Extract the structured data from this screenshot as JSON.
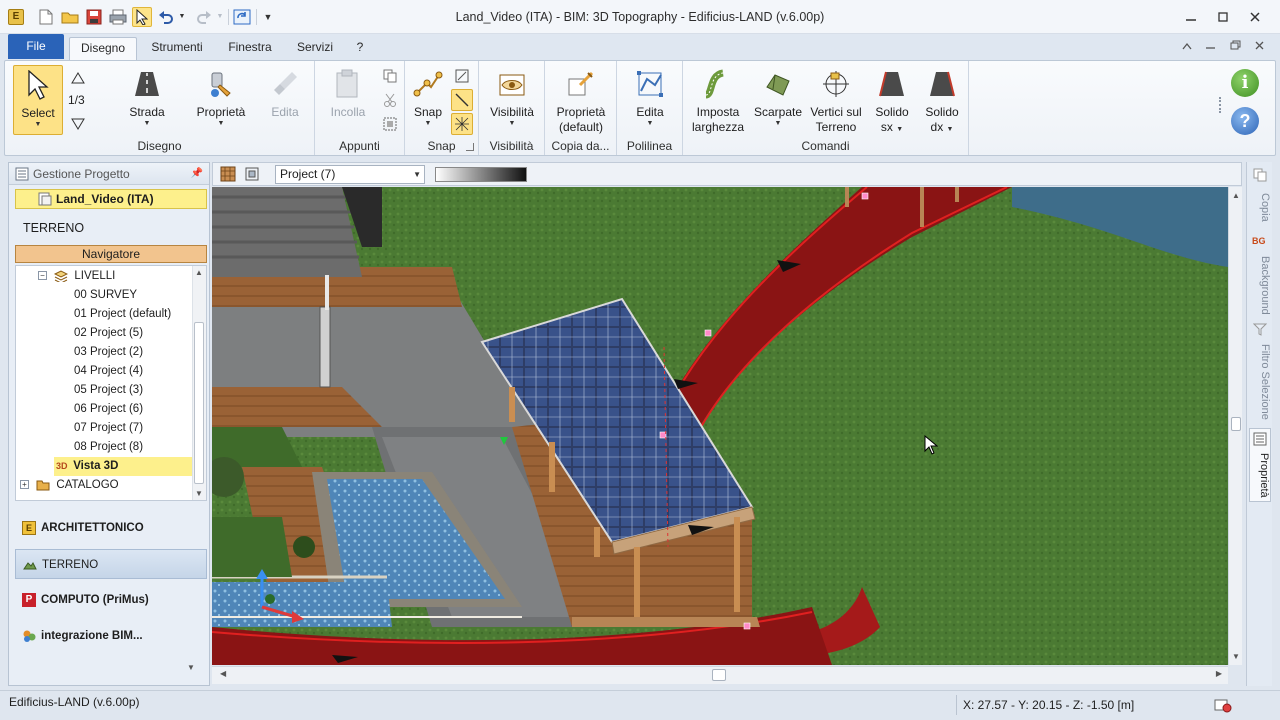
{
  "window": {
    "title": "Land_Video (ITA)  -  BIM: 3D Topography - Edificius-LAND (v.6.00p)"
  },
  "ribbon_tabs": [
    {
      "label": "File"
    },
    {
      "label": "Disegno",
      "active": true
    },
    {
      "label": "Strumenti"
    },
    {
      "label": "Finestra"
    },
    {
      "label": "Servizi"
    },
    {
      "label": "?"
    }
  ],
  "ribbon": {
    "select": {
      "label": "Select",
      "fraction": "1/3"
    },
    "groups": {
      "disegno": "Disegno",
      "appunti": "Appunti",
      "snap": "Snap",
      "visibilita": "Visibilità",
      "copia_da": "Copia da...",
      "polilinea": "Polilinea",
      "comandi": "Comandi"
    },
    "buttons": {
      "strada": "Strada",
      "proprieta": "Proprietà",
      "edita_disabled": "Edita",
      "incolla": "Incolla",
      "snap": "Snap",
      "visibilita": "Visibilità",
      "proprieta_default_1": "Proprietà",
      "proprieta_default_2": "(default)",
      "edita": "Edita",
      "imposta_1": "Imposta",
      "imposta_2": "larghezza",
      "scarpate": "Scarpate",
      "vertici_1": "Vertici sul",
      "vertici_2": "Terreno",
      "solido_sx_1": "Solido",
      "solido_sx_2": "sx",
      "solido_dx_1": "Solido",
      "solido_dx_2": "dx"
    }
  },
  "left_panel": {
    "header": "Gestione Progetto",
    "project": "Land_Video (ITA)",
    "section": "TERRENO",
    "navigator": "Navigatore",
    "tree": {
      "root": "LIVELLI",
      "levels": [
        "00 SURVEY",
        "01 Project (default)",
        "02 Project (5)",
        "03 Project (2)",
        "04 Project (4)",
        "05 Project (3)",
        "06 Project (6)",
        "07 Project (7)",
        "08 Project (8)"
      ],
      "selected": "Vista 3D",
      "catalog": "CATALOGO"
    },
    "modules": [
      {
        "label": "ARCHITETTONICO",
        "color": "#f0c13a"
      },
      {
        "label": "TERRENO",
        "color": "#5a8a4a",
        "active": true
      },
      {
        "label": "COMPUTO (PriMus)",
        "color": "#c8202a"
      },
      {
        "label": "integrazione BIM...",
        "color": "#d07a1a"
      }
    ]
  },
  "viewport_toolbar": {
    "combo_value": "Project (7)"
  },
  "right_dock": {
    "tabs": [
      "Copia",
      "Background",
      "Filtro Selezione",
      "Proprietà"
    ]
  },
  "status": {
    "left": "Edificius-LAND (v.6.00p)",
    "coords": "X: 27.57 - Y: 20.15 - Z: -1.50 [m]"
  }
}
